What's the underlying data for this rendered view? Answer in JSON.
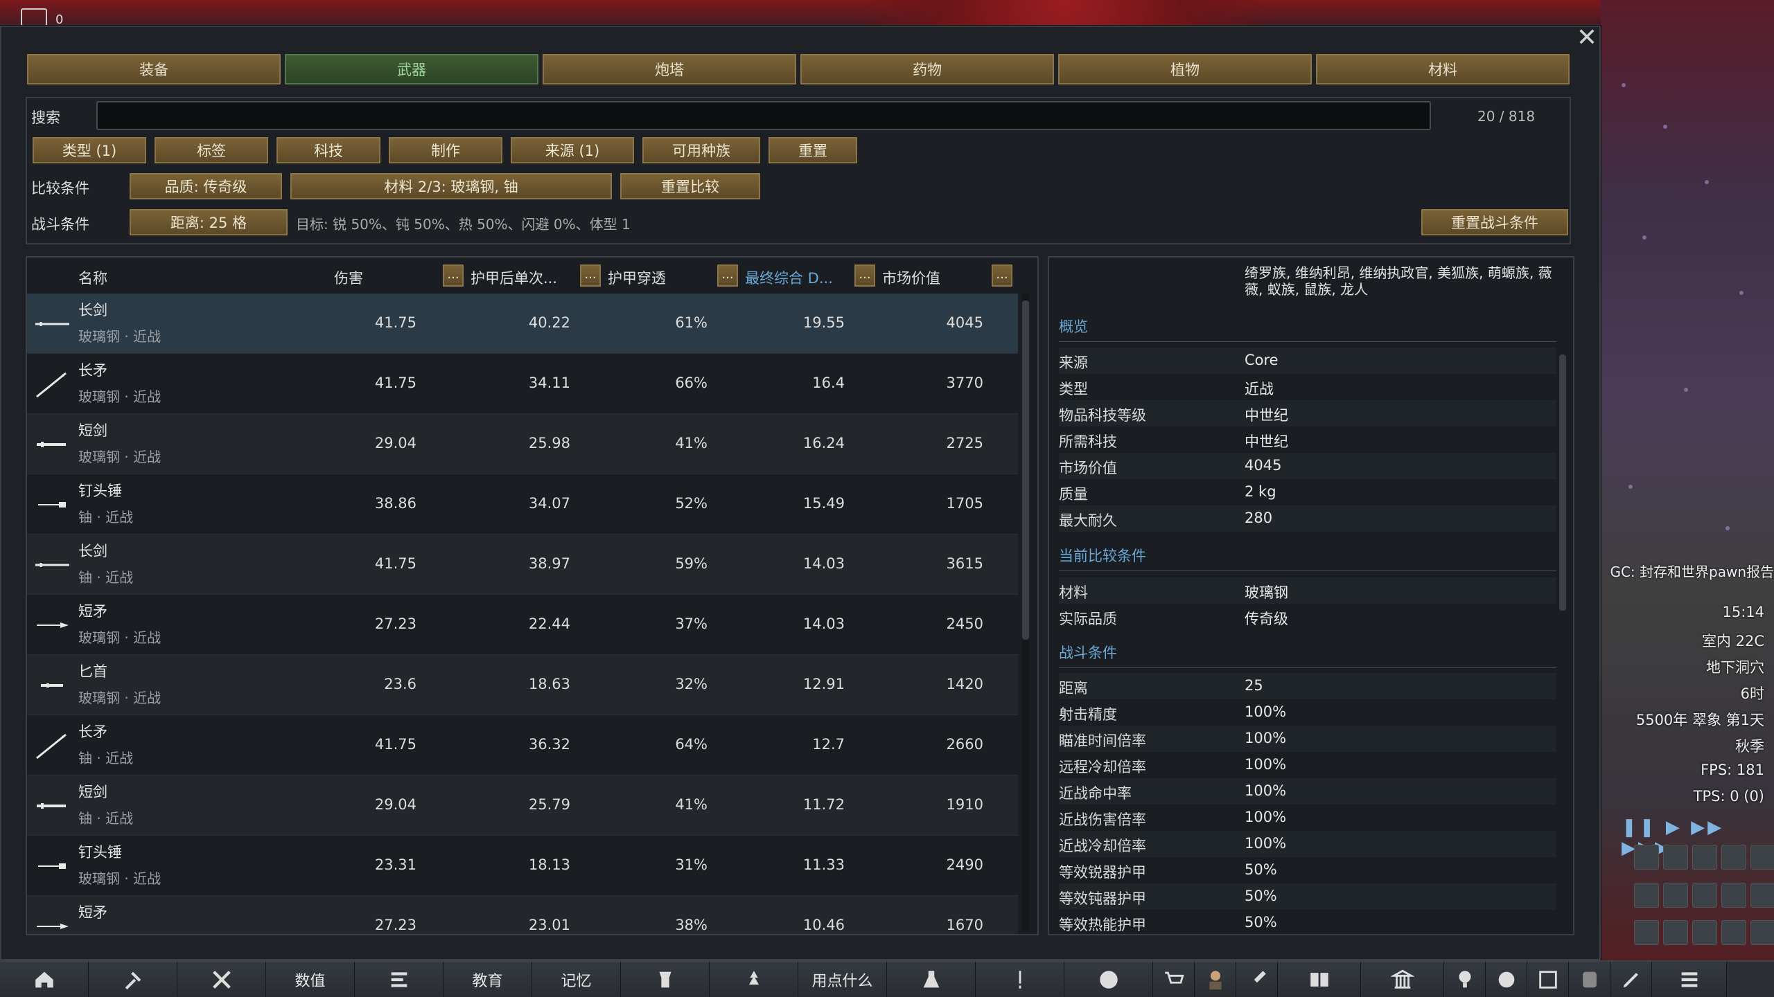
{
  "top_counter": "0",
  "tabs": [
    "装备",
    "武器",
    "炮塔",
    "药物",
    "植物",
    "材料"
  ],
  "filters": {
    "search_label": "搜索",
    "search_value": "",
    "count": "20 / 818",
    "buttons": [
      "类型 (1)",
      "标签",
      "科技",
      "制作",
      "来源 (1)",
      "可用种族",
      "重置"
    ],
    "compare_label": "比较条件",
    "compare_buttons": [
      "品质: 传奇级",
      "材料 2/3: 玻璃钢, 铀",
      "重置比较"
    ],
    "combat_label": "战斗条件",
    "combat_button": "距离: 25 格",
    "combat_desc": "目标: 锐 50%、钝 50%、热 50%、闪避 0%、体型 1",
    "combat_reset": "重置战斗条件"
  },
  "table": {
    "headers": {
      "name": "名称",
      "damage": "伤害",
      "armor_single": "护甲后单次...",
      "pen": "护甲穿透",
      "final": "最终综合 D...",
      "market": "市场价值",
      "more": "..."
    },
    "rows": [
      {
        "name": "长剑",
        "sub": "玻璃钢 · 近战",
        "icon": "longsword-icon",
        "dmg": "41.75",
        "armor": "40.22",
        "pen": "61%",
        "final": "19.55",
        "value": "4045"
      },
      {
        "name": "长矛",
        "sub": "玻璃钢 · 近战",
        "icon": "spear-icon",
        "dmg": "41.75",
        "armor": "34.11",
        "pen": "66%",
        "final": "16.4",
        "value": "3770"
      },
      {
        "name": "短剑",
        "sub": "玻璃钢 · 近战",
        "icon": "gladius-icon",
        "dmg": "29.04",
        "armor": "25.98",
        "pen": "41%",
        "final": "16.24",
        "value": "2725"
      },
      {
        "name": "钉头锤",
        "sub": "铀 · 近战",
        "icon": "mace-icon",
        "dmg": "38.86",
        "armor": "34.07",
        "pen": "52%",
        "final": "15.49",
        "value": "1705"
      },
      {
        "name": "长剑",
        "sub": "铀 · 近战",
        "icon": "longsword-icon",
        "dmg": "41.75",
        "armor": "38.97",
        "pen": "59%",
        "final": "14.03",
        "value": "3615"
      },
      {
        "name": "短矛",
        "sub": "玻璃钢 · 近战",
        "icon": "short-spear-icon",
        "dmg": "27.23",
        "armor": "22.44",
        "pen": "37%",
        "final": "14.03",
        "value": "2450"
      },
      {
        "name": "匕首",
        "sub": "玻璃钢 · 近战",
        "icon": "knife-icon",
        "dmg": "23.6",
        "armor": "18.63",
        "pen": "32%",
        "final": "12.91",
        "value": "1420"
      },
      {
        "name": "长矛",
        "sub": "铀 · 近战",
        "icon": "spear-icon",
        "dmg": "41.75",
        "armor": "36.32",
        "pen": "64%",
        "final": "12.7",
        "value": "2660"
      },
      {
        "name": "短剑",
        "sub": "铀 · 近战",
        "icon": "gladius-icon",
        "dmg": "29.04",
        "armor": "25.79",
        "pen": "41%",
        "final": "11.72",
        "value": "1910"
      },
      {
        "name": "钉头锤",
        "sub": "玻璃钢 · 近战",
        "icon": "mace-icon",
        "dmg": "23.31",
        "armor": "18.13",
        "pen": "31%",
        "final": "11.33",
        "value": "2490"
      },
      {
        "name": "短矛",
        "sub": "",
        "icon": "short-spear-icon",
        "dmg": "27.23",
        "armor": "23.01",
        "pen": "38%",
        "final": "10.46",
        "value": "1670"
      }
    ]
  },
  "detail": {
    "races": "绮罗族, 维纳利昂, 维纳执政官, 美狐族, 萌螈族, 薇薇, 蚁族, 鼠族, 龙人",
    "overview_title": "概览",
    "overview": [
      [
        "来源",
        "Core"
      ],
      [
        "类型",
        "近战"
      ],
      [
        "物品科技等级",
        "中世纪"
      ],
      [
        "所需科技",
        "中世纪"
      ],
      [
        "市场价值",
        "4045"
      ],
      [
        "质量",
        "2 kg"
      ],
      [
        "最大耐久",
        "280"
      ]
    ],
    "compare_title": "当前比较条件",
    "compare": [
      [
        "材料",
        "玻璃钢"
      ],
      [
        "实际品质",
        "传奇级"
      ]
    ],
    "combat_title": "战斗条件",
    "combat": [
      [
        "距离",
        "25"
      ],
      [
        "射击精度",
        "100%"
      ],
      [
        "瞄准时间倍率",
        "100%"
      ],
      [
        "远程冷却倍率",
        "100%"
      ],
      [
        "近战命中率",
        "100%"
      ],
      [
        "近战伤害倍率",
        "100%"
      ],
      [
        "近战冷却倍率",
        "100%"
      ],
      [
        "等效锐器护甲",
        "50%"
      ],
      [
        "等效钝器护甲",
        "50%"
      ],
      [
        "等效热能护甲",
        "50%"
      ]
    ]
  },
  "hud": {
    "alert": "GC: 封存和世界pawn报告",
    "time": "15:14",
    "temp": "室内 22C",
    "location": "地下洞穴",
    "hour": "6时",
    "date": "5500年 翠象 第1天",
    "season": "秋季",
    "fps": "FPS: 181",
    "tps": "TPS: 0 (0)"
  },
  "bottom_bar": {
    "stats": "数值",
    "education": "教育",
    "memory": "记忆",
    "what_to_use": "用点什么"
  }
}
